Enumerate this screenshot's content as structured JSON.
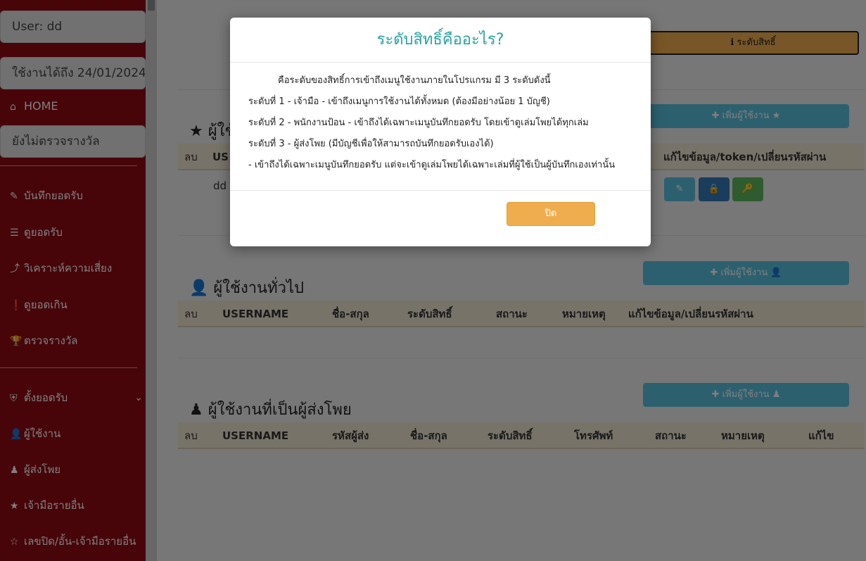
{
  "sidebar": {
    "user_box": "User: dd",
    "expiry_box": "ใช้งานได้ถึง 24/01/2024",
    "home": "HOME",
    "status_box": "ยังไม่ตรวจรางวัล",
    "items": [
      {
        "icon": "✎",
        "label": "บันทึกยอดรับ"
      },
      {
        "icon": "☰",
        "label": "ดูยอดรับ"
      },
      {
        "icon": "⤴",
        "label": "วิเคราะห์ความเสี่ยง"
      },
      {
        "icon": "❗",
        "label": "ดูยอดเกิน"
      },
      {
        "icon": "🏆",
        "label": "ตรวจรางวัล"
      },
      {
        "icon": "⛨",
        "label": "ตั้งยอดรับ"
      },
      {
        "icon": "👤",
        "label": "ผู้ใช้งาน"
      },
      {
        "icon": "♟",
        "label": "ผู้ส่งโพย"
      },
      {
        "icon": "★",
        "label": "เจ้ามือรายอื่น"
      },
      {
        "icon": "☆",
        "label": "เลขปิด/อั้น-เจ้ามือรายอื่น"
      }
    ]
  },
  "main": {
    "perm_button": "ℹ ระดับสิทธิ์",
    "owner": {
      "title": "ผู้ใช้",
      "add_button": "✚ เพิ่มผู้ใช้งาน ★",
      "headers": [
        "ลบ",
        "US",
        "แก้ไขข้อมูล/token/เปลี่ยนรหัสผ่าน"
      ],
      "row_username": "dd",
      "actions": [
        "✎",
        "🔒",
        "🔑"
      ]
    },
    "general": {
      "title": "ผู้ใช้งานทั่วไป",
      "add_button": "✚ เพิ่มผู้ใช้งาน 👤",
      "headers": [
        "ลบ",
        "USERNAME",
        "ชื่อ-สกุล",
        "ระดับสิทธิ์",
        "สถานะ",
        "หมายเหตุ",
        "แก้ไขข้อมูล/เปลี่ยนรหัสผ่าน"
      ]
    },
    "sender": {
      "title": "ผู้ใช้งานที่เป็นผู้ส่งโพย",
      "add_button": "✚ เพิ่มผู้ใช้งาน ♟",
      "headers": [
        "ลบ",
        "USERNAME",
        "รหัสผู้ส่ง",
        "ชื่อ-สกุล",
        "ระดับสิทธิ์",
        "โทรศัพท์",
        "สถานะ",
        "หมายเหตุ",
        "แก้ไข"
      ]
    }
  },
  "modal": {
    "title": "ระดับสิทธิ์คืออะไร?",
    "lines": [
      "คือระดับของสิทธิ์การเข้าถึงเมนูใช้งานภายในโปรแกรม มี 3 ระดับดังนี้",
      "ระดับที่ 1 - เจ้ามือ - เข้าถึงเมนูการใช้งานได้ทั้งหมด (ต้องมีอย่างน้อย 1 บัญชี)",
      "ระดับที่ 2 - พนักงานป้อน - เข้าถึงได้เฉพาะเมนูบันทึกยอดรับ โดยเข้าดูเล่มโพยได้ทุกเล่ม",
      "ระดับที่ 3 - ผู้ส่งโพย (มีบัญชีเพื่อให้สามารถบันทึกยอดรับเองได้)",
      "- เข้าถึงได้เฉพาะเมนูบันทึกยอดรับ แต่จะเข้าดูเล่มโพยได้เฉพาะเล่มที่ผู้ใช้เป็นผู้บันทึกเองเท่านั้น"
    ],
    "close_button": "ปิด"
  }
}
